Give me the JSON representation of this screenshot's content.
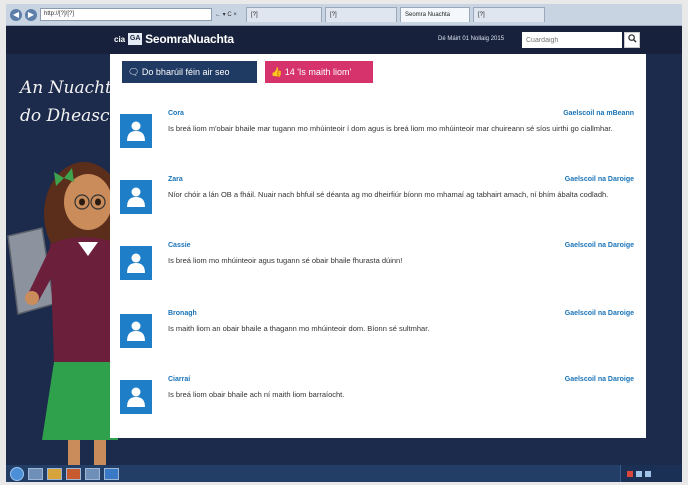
{
  "browser": {
    "address": "http://[?]/[?]",
    "address_tools": "← ▾ C ×",
    "tabs": [
      {
        "label": "[?]"
      },
      {
        "label": "[?]"
      },
      {
        "label": "Seomra Nuachta",
        "active": true
      },
      {
        "label": "[?]"
      }
    ]
  },
  "site": {
    "logo_prefix": "cia",
    "logo_badge": "GA",
    "logo_text": "SeomraNuachta",
    "date": "Dé Máirt 01 Nollaig 2015",
    "search_placeholder": "Cuardaigh",
    "search_icon": "magnifier-icon"
  },
  "background": {
    "line1": "An Nuacht",
    "line2": "do Dheasc"
  },
  "actions": {
    "opinion_label": "🗨 Do bharúil féin air seo",
    "like_label": "👍 14 'Is maith liom'"
  },
  "comments": [
    {
      "name": "Cora",
      "school": "Gaelscoil na mBeann",
      "text": "Is breá liom m'obair bhaile mar tugann mo mhúinteoir í dom agus is breá liom mo mhúinteoir mar chuireann sé síos uirthi go ciallmhar."
    },
    {
      "name": "Zara",
      "school": "Gaelscoil na Daroige",
      "text": "Níor chóir a lán OB a fháil. Nuair nach bhfuil sé déanta ag mo dheirfiúr bíonn mo mhamaí ag tabhairt amach, ní bhím ábalta codladh."
    },
    {
      "name": "Cassie",
      "school": "Gaelscoil na Daroige",
      "text": "Is breá liom mo mhúinteoir agus tugann sé obair bhaile fhurasta dúinn!"
    },
    {
      "name": "Bronagh",
      "school": "Gaelscoil na Daroige",
      "text": "Is maith liom an obair bhaile a thagann mo mhúinteoir dom. Bíonn sé sultmhar."
    },
    {
      "name": "Ciarraí",
      "school": "Gaelscoil na Daroige",
      "text": "Is breá liom obair bhaile ach ní maith liom barraíocht."
    }
  ],
  "colors": {
    "header_bg": "#17213b",
    "primary_button": "#1f3a63",
    "like_button": "#d6336c",
    "avatar": "#1e7fc8",
    "link": "#1a73b8"
  }
}
